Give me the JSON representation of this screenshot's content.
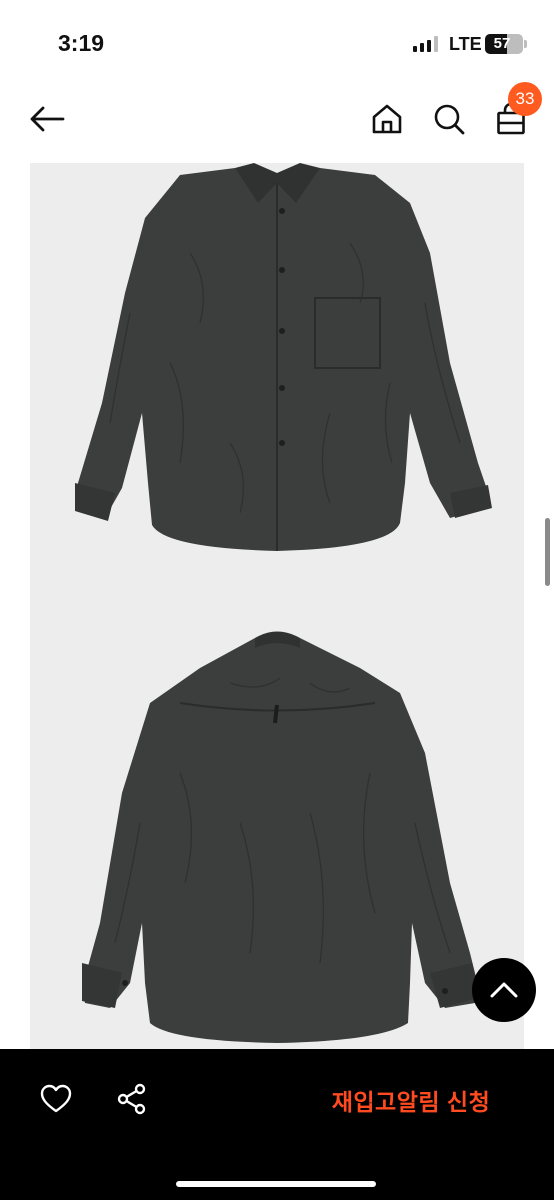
{
  "status_bar": {
    "time": "3:19",
    "network": "LTE",
    "battery": "57",
    "battery_level": 0.57
  },
  "header": {
    "icons": [
      "back-arrow-icon",
      "home-icon",
      "search-icon",
      "shopping-bag-icon"
    ],
    "cart_badge": "33"
  },
  "product_images": [
    "shirt front view",
    "shirt back view"
  ],
  "bottom_bar": {
    "restock_label": "재입고알림 신청",
    "icons": [
      "heart-icon",
      "share-icon"
    ]
  },
  "colors": {
    "accent": "#ff5a1f",
    "restock_text": "#ff4b1f",
    "bottom_bar_bg": "#000000",
    "image_bg": "#ededed",
    "shirt": "#3a3d3c"
  }
}
